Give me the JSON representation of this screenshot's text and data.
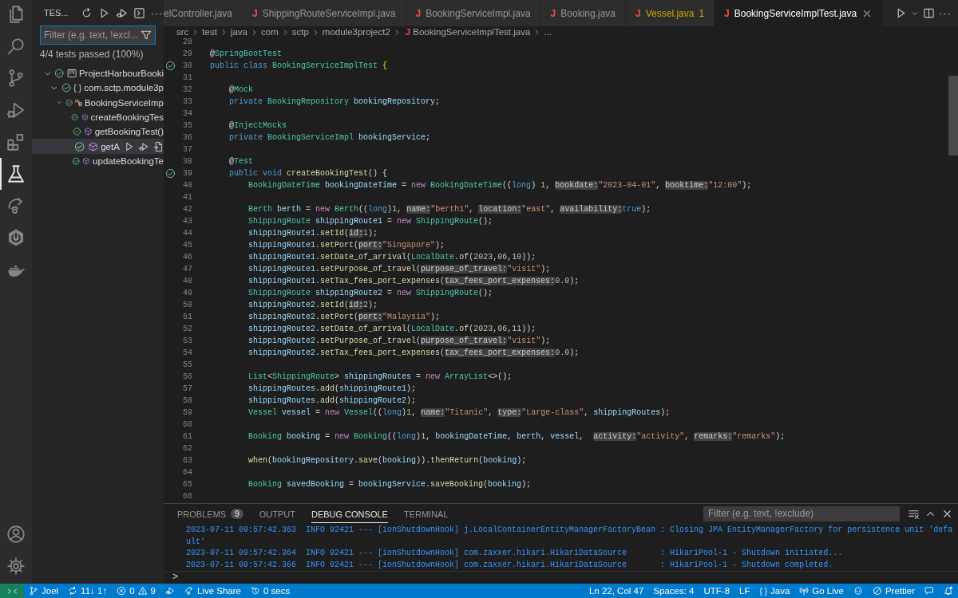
{
  "activity_bar": {
    "items": [
      {
        "kind": "explorer",
        "selected": false
      },
      {
        "kind": "search",
        "selected": false
      },
      {
        "kind": "scm",
        "selected": false
      },
      {
        "kind": "debug",
        "selected": false
      },
      {
        "kind": "extensions",
        "selected": false
      },
      {
        "kind": "testing",
        "selected": true
      },
      {
        "kind": "liveshare",
        "selected": false
      },
      {
        "kind": "spring",
        "selected": false
      },
      {
        "kind": "docker",
        "selected": false
      }
    ],
    "bottom": [
      {
        "kind": "account"
      },
      {
        "kind": "settings"
      }
    ]
  },
  "sidebar": {
    "title": "TES...",
    "actions": [
      {
        "kind": "refresh"
      },
      {
        "kind": "run"
      },
      {
        "kind": "debug"
      },
      {
        "kind": "terminal"
      }
    ],
    "more": "···",
    "filter": {
      "placeholder": "Filter (e.g. text, !excl..."
    },
    "summary": "4/4 tests passed (100%)",
    "tree": [
      {
        "kind": "project",
        "label": "ProjectHarbourBooki",
        "passed": true,
        "expanded": true,
        "selected": false,
        "children": [
          {
            "kind": "package",
            "glyph": "{ }",
            "label": "com.sctp.module3p",
            "passed": true,
            "expanded": true,
            "selected": false,
            "children": [
              {
                "kind": "class",
                "label": "BookingServiceImp",
                "passed": true,
                "expanded": true,
                "selected": false,
                "children": [
                  {
                    "kind": "method",
                    "label": "createBookingTes",
                    "passed": true,
                    "selected": false
                  },
                  {
                    "kind": "method",
                    "label": "getBookingTest()",
                    "passed": true,
                    "selected": false
                  },
                  {
                    "kind": "method",
                    "label": "getA",
                    "passed": true,
                    "selected": true
                  },
                  {
                    "kind": "method",
                    "label": "updateBookingTe",
                    "passed": true,
                    "selected": false
                  }
                ]
              }
            ]
          }
        ]
      }
    ]
  },
  "tabs": [
    {
      "label": "elController.java",
      "selected": false,
      "warning": false
    },
    {
      "icon": "J",
      "label": "ShippingRouteServiceImpl.java",
      "selected": false,
      "warning": false
    },
    {
      "icon": "J",
      "label": "BookingServiceImpl.java",
      "selected": false,
      "warning": false
    },
    {
      "icon": "J",
      "label": "Booking.java",
      "selected": false,
      "warning": false
    },
    {
      "icon": "J",
      "label": "Vessel.java",
      "badge": "1",
      "selected": false,
      "warning": true
    },
    {
      "icon": "J",
      "label": "BookingServiceImplTest.java",
      "selected": true,
      "warning": false
    }
  ],
  "editor_actions": [
    {
      "kind": "run"
    },
    {
      "kind": "caret"
    },
    {
      "kind": "split"
    }
  ],
  "editor_more": "···",
  "breadcrumb": [
    {
      "text": "src"
    },
    {
      "text": "test"
    },
    {
      "text": "java"
    },
    {
      "text": "com"
    },
    {
      "text": "sctp"
    },
    {
      "text": "module3project2"
    },
    {
      "icon": "J",
      "text": "BookingServiceImplTest.java"
    },
    {
      "text": "..."
    }
  ],
  "editor": {
    "lines": [
      {
        "number": "28"
      },
      {
        "number": "29",
        "tokens": [
          {
            "kind": "plain",
            "text": "@"
          },
          {
            "kind": "type",
            "text": "SpringBootTest"
          }
        ]
      },
      {
        "number": "30",
        "test_passed": true,
        "tokens": [
          {
            "kind": "kw",
            "text": "public class "
          },
          {
            "kind": "type",
            "text": "BookingServiceImplTest"
          },
          {
            "kind": "brace",
            "text": " {"
          }
        ]
      },
      {
        "number": "31"
      },
      {
        "number": "32",
        "tokens": [
          {
            "kind": "plain",
            "text": "    @"
          },
          {
            "kind": "type",
            "text": "Mock"
          }
        ]
      },
      {
        "number": "33",
        "tokens": [
          {
            "kind": "kw",
            "text": "    private "
          },
          {
            "kind": "type",
            "text": "BookingRepository"
          },
          {
            "kind": "var",
            "text": " bookingRepository"
          },
          {
            "kind": "plain",
            "text": ";"
          }
        ]
      },
      {
        "number": "34"
      },
      {
        "number": "35",
        "tokens": [
          {
            "kind": "plain",
            "text": "    @"
          },
          {
            "kind": "type",
            "text": "InjectMocks"
          }
        ]
      },
      {
        "number": "36",
        "tokens": [
          {
            "kind": "kw",
            "text": "    private "
          },
          {
            "kind": "type",
            "text": "BookingServiceImpl"
          },
          {
            "kind": "var",
            "text": " bookingService"
          },
          {
            "kind": "plain",
            "text": ";"
          }
        ]
      },
      {
        "number": "37"
      },
      {
        "number": "38",
        "tokens": [
          {
            "kind": "plain",
            "text": "    @"
          },
          {
            "kind": "type",
            "text": "Test"
          }
        ]
      },
      {
        "number": "39",
        "test_passed": true,
        "tokens": [
          {
            "kind": "kw",
            "text": "    public void "
          },
          {
            "kind": "fn",
            "text": "createBookingTest"
          },
          {
            "kind": "plain",
            "text": "() {"
          }
        ]
      },
      {
        "number": "40",
        "tokens": [
          {
            "kind": "type",
            "text": "        BookingDateTime"
          },
          {
            "kind": "var",
            "text": " bookingDateTime"
          },
          {
            "kind": "plain",
            "text": " = "
          },
          {
            "kind": "ctl",
            "text": "new"
          },
          {
            "kind": "type",
            "text": " BookingDateTime"
          },
          {
            "kind": "plain",
            "text": "(("
          },
          {
            "kind": "kw",
            "text": "long"
          },
          {
            "kind": "plain",
            "text": ") "
          },
          {
            "kind": "num",
            "text": "1"
          },
          {
            "kind": "plain",
            "text": ", "
          },
          {
            "kind": "hint",
            "text": "bookdate:"
          },
          {
            "kind": "str",
            "text": "\"2023-04-01\""
          },
          {
            "kind": "plain",
            "text": ", "
          },
          {
            "kind": "hint",
            "text": "booktime:"
          },
          {
            "kind": "str",
            "text": "\"12:00\""
          },
          {
            "kind": "plain",
            "text": ");"
          }
        ]
      },
      {
        "number": "41"
      },
      {
        "number": "42",
        "tokens": [
          {
            "kind": "type",
            "text": "        Berth"
          },
          {
            "kind": "var",
            "text": " berth"
          },
          {
            "kind": "plain",
            "text": " = "
          },
          {
            "kind": "ctl",
            "text": "new"
          },
          {
            "kind": "type",
            "text": " Berth"
          },
          {
            "kind": "plain",
            "text": "(("
          },
          {
            "kind": "kw",
            "text": "long"
          },
          {
            "kind": "plain",
            "text": ")"
          },
          {
            "kind": "num",
            "text": "1"
          },
          {
            "kind": "plain",
            "text": ", "
          },
          {
            "kind": "hint",
            "text": "name:"
          },
          {
            "kind": "str",
            "text": "\"berth1\""
          },
          {
            "kind": "plain",
            "text": ", "
          },
          {
            "kind": "hint",
            "text": "location:"
          },
          {
            "kind": "str",
            "text": "\"east\""
          },
          {
            "kind": "plain",
            "text": ", "
          },
          {
            "kind": "hint",
            "text": "availability:"
          },
          {
            "kind": "kw",
            "text": "true"
          },
          {
            "kind": "plain",
            "text": ");"
          }
        ]
      },
      {
        "number": "43",
        "tokens": [
          {
            "kind": "type",
            "text": "        ShippingRoute"
          },
          {
            "kind": "var",
            "text": " shippingRoute1"
          },
          {
            "kind": "plain",
            "text": " = "
          },
          {
            "kind": "ctl",
            "text": "new"
          },
          {
            "kind": "type",
            "text": " ShippingRoute"
          },
          {
            "kind": "plain",
            "text": "();"
          }
        ]
      },
      {
        "number": "44",
        "tokens": [
          {
            "kind": "var",
            "text": "        shippingRoute1"
          },
          {
            "kind": "plain",
            "text": "."
          },
          {
            "kind": "fn",
            "text": "setId"
          },
          {
            "kind": "plain",
            "text": "("
          },
          {
            "kind": "hint",
            "text": "id:"
          },
          {
            "kind": "num",
            "text": "1"
          },
          {
            "kind": "plain",
            "text": ");"
          }
        ]
      },
      {
        "number": "45",
        "tokens": [
          {
            "kind": "var",
            "text": "        shippingRoute1"
          },
          {
            "kind": "plain",
            "text": "."
          },
          {
            "kind": "fn",
            "text": "setPort"
          },
          {
            "kind": "plain",
            "text": "("
          },
          {
            "kind": "hint",
            "text": "port:"
          },
          {
            "kind": "str",
            "text": "\"Singapore\""
          },
          {
            "kind": "plain",
            "text": ");"
          }
        ]
      },
      {
        "number": "46",
        "tokens": [
          {
            "kind": "var",
            "text": "        shippingRoute1"
          },
          {
            "kind": "plain",
            "text": "."
          },
          {
            "kind": "fn",
            "text": "setDate_of_arrival"
          },
          {
            "kind": "plain",
            "text": "("
          },
          {
            "kind": "type",
            "text": "LocalDate"
          },
          {
            "kind": "plain",
            "text": "."
          },
          {
            "kind": "fn",
            "text": "of"
          },
          {
            "kind": "plain",
            "text": "("
          },
          {
            "kind": "num",
            "text": "2023"
          },
          {
            "kind": "plain",
            "text": ","
          },
          {
            "kind": "num",
            "text": "06"
          },
          {
            "kind": "plain",
            "text": ","
          },
          {
            "kind": "num",
            "text": "10"
          },
          {
            "kind": "plain",
            "text": "));"
          }
        ]
      },
      {
        "number": "47",
        "tokens": [
          {
            "kind": "var",
            "text": "        shippingRoute1"
          },
          {
            "kind": "plain",
            "text": "."
          },
          {
            "kind": "fn",
            "text": "setPurpose_of_travel"
          },
          {
            "kind": "plain",
            "text": "("
          },
          {
            "kind": "hint",
            "text": "purpose_of_travel:"
          },
          {
            "kind": "str",
            "text": "\"visit\""
          },
          {
            "kind": "plain",
            "text": ");"
          }
        ]
      },
      {
        "number": "48",
        "tokens": [
          {
            "kind": "var",
            "text": "        shippingRoute1"
          },
          {
            "kind": "plain",
            "text": "."
          },
          {
            "kind": "fn",
            "text": "setTax_fees_port_expenses"
          },
          {
            "kind": "plain",
            "text": "("
          },
          {
            "kind": "hint",
            "text": "tax_fees_port_expenses:"
          },
          {
            "kind": "num",
            "text": "0.0"
          },
          {
            "kind": "plain",
            "text": ");"
          }
        ]
      },
      {
        "number": "49",
        "tokens": [
          {
            "kind": "type",
            "text": "        ShippingRoute"
          },
          {
            "kind": "var",
            "text": " shippingRoute2"
          },
          {
            "kind": "plain",
            "text": " = "
          },
          {
            "kind": "ctl",
            "text": "new"
          },
          {
            "kind": "type",
            "text": " ShippingRoute"
          },
          {
            "kind": "plain",
            "text": "();"
          }
        ]
      },
      {
        "number": "50",
        "tokens": [
          {
            "kind": "var",
            "text": "        shippingRoute2"
          },
          {
            "kind": "plain",
            "text": "."
          },
          {
            "kind": "fn",
            "text": "setId"
          },
          {
            "kind": "plain",
            "text": "("
          },
          {
            "kind": "hint",
            "text": "id:"
          },
          {
            "kind": "num",
            "text": "2"
          },
          {
            "kind": "plain",
            "text": ");"
          }
        ]
      },
      {
        "number": "51",
        "tokens": [
          {
            "kind": "var",
            "text": "        shippingRoute2"
          },
          {
            "kind": "plain",
            "text": "."
          },
          {
            "kind": "fn",
            "text": "setPort"
          },
          {
            "kind": "plain",
            "text": "("
          },
          {
            "kind": "hint",
            "text": "port:"
          },
          {
            "kind": "str",
            "text": "\"Malaysia\""
          },
          {
            "kind": "plain",
            "text": ");"
          }
        ]
      },
      {
        "number": "52",
        "tokens": [
          {
            "kind": "var",
            "text": "        shippingRoute2"
          },
          {
            "kind": "plain",
            "text": "."
          },
          {
            "kind": "fn",
            "text": "setDate_of_arrival"
          },
          {
            "kind": "plain",
            "text": "("
          },
          {
            "kind": "type",
            "text": "LocalDate"
          },
          {
            "kind": "plain",
            "text": "."
          },
          {
            "kind": "fn",
            "text": "of"
          },
          {
            "kind": "plain",
            "text": "("
          },
          {
            "kind": "num",
            "text": "2023"
          },
          {
            "kind": "plain",
            "text": ","
          },
          {
            "kind": "num",
            "text": "06"
          },
          {
            "kind": "plain",
            "text": ","
          },
          {
            "kind": "num",
            "text": "11"
          },
          {
            "kind": "plain",
            "text": "));"
          }
        ]
      },
      {
        "number": "53",
        "tokens": [
          {
            "kind": "var",
            "text": "        shippingRoute2"
          },
          {
            "kind": "plain",
            "text": "."
          },
          {
            "kind": "fn",
            "text": "setPurpose_of_travel"
          },
          {
            "kind": "plain",
            "text": "("
          },
          {
            "kind": "hint",
            "text": "purpose_of_travel:"
          },
          {
            "kind": "str",
            "text": "\"visit\""
          },
          {
            "kind": "plain",
            "text": ");"
          }
        ]
      },
      {
        "number": "54",
        "tokens": [
          {
            "kind": "var",
            "text": "        shippingRoute2"
          },
          {
            "kind": "plain",
            "text": "."
          },
          {
            "kind": "fn",
            "text": "setTax_fees_port_expenses"
          },
          {
            "kind": "plain",
            "text": "("
          },
          {
            "kind": "hint",
            "text": "tax_fees_port_expenses:"
          },
          {
            "kind": "num",
            "text": "0.0"
          },
          {
            "kind": "plain",
            "text": ");"
          }
        ]
      },
      {
        "number": "55"
      },
      {
        "number": "56",
        "tokens": [
          {
            "kind": "type",
            "text": "        List"
          },
          {
            "kind": "plain",
            "text": "<"
          },
          {
            "kind": "type",
            "text": "ShippingRoute"
          },
          {
            "kind": "plain",
            "text": ">"
          },
          {
            "kind": "var",
            "text": " shippingRoutes"
          },
          {
            "kind": "plain",
            "text": " = "
          },
          {
            "kind": "ctl",
            "text": "new"
          },
          {
            "kind": "type",
            "text": " ArrayList"
          },
          {
            "kind": "plain",
            "text": "<>();"
          }
        ]
      },
      {
        "number": "57",
        "tokens": [
          {
            "kind": "var",
            "text": "        shippingRoutes"
          },
          {
            "kind": "plain",
            "text": "."
          },
          {
            "kind": "fn",
            "text": "add"
          },
          {
            "kind": "plain",
            "text": "("
          },
          {
            "kind": "var",
            "text": "shippingRoute1"
          },
          {
            "kind": "plain",
            "text": ");"
          }
        ]
      },
      {
        "number": "58",
        "tokens": [
          {
            "kind": "var",
            "text": "        shippingRoutes"
          },
          {
            "kind": "plain",
            "text": "."
          },
          {
            "kind": "fn",
            "text": "add"
          },
          {
            "kind": "plain",
            "text": "("
          },
          {
            "kind": "var",
            "text": "shippingRoute2"
          },
          {
            "kind": "plain",
            "text": ");"
          }
        ]
      },
      {
        "number": "59",
        "tokens": [
          {
            "kind": "type",
            "text": "        Vessel"
          },
          {
            "kind": "var",
            "text": " vessel"
          },
          {
            "kind": "plain",
            "text": " = "
          },
          {
            "kind": "ctl",
            "text": "new"
          },
          {
            "kind": "type",
            "text": " Vessel"
          },
          {
            "kind": "plain",
            "text": "(("
          },
          {
            "kind": "kw",
            "text": "long"
          },
          {
            "kind": "plain",
            "text": ")"
          },
          {
            "kind": "num",
            "text": "1"
          },
          {
            "kind": "plain",
            "text": ", "
          },
          {
            "kind": "hint",
            "text": "name:"
          },
          {
            "kind": "str",
            "text": "\"Titanic\""
          },
          {
            "kind": "plain",
            "text": ", "
          },
          {
            "kind": "hint",
            "text": "type:"
          },
          {
            "kind": "str",
            "text": "\"Large-class\""
          },
          {
            "kind": "plain",
            "text": ", "
          },
          {
            "kind": "var",
            "text": "shippingRoutes"
          },
          {
            "kind": "plain",
            "text": ");"
          }
        ]
      },
      {
        "number": "60"
      },
      {
        "number": "61",
        "tokens": [
          {
            "kind": "type",
            "text": "        Booking"
          },
          {
            "kind": "var",
            "text": " booking"
          },
          {
            "kind": "plain",
            "text": " = "
          },
          {
            "kind": "ctl",
            "text": "new"
          },
          {
            "kind": "type",
            "text": " Booking"
          },
          {
            "kind": "plain",
            "text": "(("
          },
          {
            "kind": "kw",
            "text": "long"
          },
          {
            "kind": "plain",
            "text": ")"
          },
          {
            "kind": "num",
            "text": "1"
          },
          {
            "kind": "plain",
            "text": ", "
          },
          {
            "kind": "var",
            "text": "bookingDateTime"
          },
          {
            "kind": "plain",
            "text": ", "
          },
          {
            "kind": "var",
            "text": "berth"
          },
          {
            "kind": "plain",
            "text": ", "
          },
          {
            "kind": "var",
            "text": "vessel"
          },
          {
            "kind": "plain",
            "text": ",  "
          },
          {
            "kind": "hint",
            "text": "activity:"
          },
          {
            "kind": "str",
            "text": "\"activity\""
          },
          {
            "kind": "plain",
            "text": ", "
          },
          {
            "kind": "hint",
            "text": "remarks:"
          },
          {
            "kind": "str",
            "text": "\"remarks\""
          },
          {
            "kind": "plain",
            "text": ");"
          }
        ]
      },
      {
        "number": "62"
      },
      {
        "number": "63",
        "tokens": [
          {
            "kind": "fn",
            "text": "        when"
          },
          {
            "kind": "plain",
            "text": "("
          },
          {
            "kind": "var",
            "text": "bookingRepository"
          },
          {
            "kind": "plain",
            "text": "."
          },
          {
            "kind": "fn",
            "text": "save"
          },
          {
            "kind": "plain",
            "text": "("
          },
          {
            "kind": "var",
            "text": "booking"
          },
          {
            "kind": "plain",
            "text": "))."
          },
          {
            "kind": "fn",
            "text": "thenReturn"
          },
          {
            "kind": "plain",
            "text": "("
          },
          {
            "kind": "var",
            "text": "booking"
          },
          {
            "kind": "plain",
            "text": ");"
          }
        ]
      },
      {
        "number": "64"
      },
      {
        "number": "65",
        "tokens": [
          {
            "kind": "type",
            "text": "        Booking"
          },
          {
            "kind": "var",
            "text": " savedBooking"
          },
          {
            "kind": "plain",
            "text": " = "
          },
          {
            "kind": "var",
            "text": "bookingService"
          },
          {
            "kind": "plain",
            "text": "."
          },
          {
            "kind": "fn",
            "text": "saveBooking"
          },
          {
            "kind": "plain",
            "text": "("
          },
          {
            "kind": "var",
            "text": "booking"
          },
          {
            "kind": "plain",
            "text": ");"
          }
        ]
      },
      {
        "number": "66"
      }
    ]
  },
  "panel": {
    "tabs": [
      {
        "label": "PROBLEMS",
        "badge": "9",
        "selected": false
      },
      {
        "label": "OUTPUT",
        "selected": false
      },
      {
        "label": "DEBUG CONSOLE",
        "selected": true
      },
      {
        "label": "TERMINAL",
        "selected": false
      }
    ],
    "filter": {
      "placeholder": "Filter (e.g. text, !exclude)"
    },
    "actions": [
      {
        "kind": "clear"
      },
      {
        "kind": "up"
      },
      {
        "kind": "close"
      }
    ],
    "log": [
      "2023-07-11 09:57:42.363  INFO 92421 --- [ionShutdownHook] j.LocalContainerEntityManagerFactoryBean : Closing JPA EntityManagerFactory for persistence unit 'default'",
      "2023-07-11 09:57:42.364  INFO 92421 --- [ionShutdownHook] com.zaxxer.hikari.HikariDataSource       : HikariPool-1 - Shutdown initiated...",
      "2023-07-11 09:57:42.366  INFO 92421 --- [ionShutdownHook] com.zaxxer.hikari.HikariDataSource       : HikariPool-1 - Shutdown completed."
    ],
    "prompt": ">"
  },
  "status_bar": {
    "left": [
      {
        "kind": "remote"
      },
      {
        "kind": "branch",
        "text": "Joel"
      },
      {
        "kind": "sync",
        "text": "11↓ 1↑"
      },
      {
        "kind": "problems",
        "errors": "0",
        "warnings": "9"
      },
      {
        "kind": "debug"
      },
      {
        "kind": "liveshare",
        "text": "Live Share"
      },
      {
        "kind": "history",
        "text": "0 secs"
      }
    ],
    "right": [
      {
        "kind": "text",
        "text": "Ln 22, Col 47"
      },
      {
        "kind": "text",
        "text": "Spaces: 4"
      },
      {
        "kind": "text",
        "text": "UTF-8"
      },
      {
        "kind": "text",
        "text": "LF"
      },
      {
        "kind": "language",
        "glyph": "{ }",
        "text": "Java"
      },
      {
        "kind": "golive",
        "text": "Go Live"
      },
      {
        "kind": "copilot"
      },
      {
        "kind": "prettier",
        "text": "Prettier"
      },
      {
        "kind": "feedback"
      },
      {
        "kind": "bell"
      }
    ]
  }
}
